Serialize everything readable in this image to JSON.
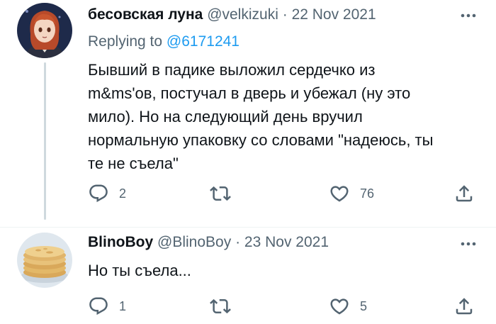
{
  "tweets": [
    {
      "author_name": "бесовская луна",
      "handle": "@velkizuki",
      "separator": "·",
      "date": "22 Nov 2021",
      "reply_prefix": "Replying to",
      "reply_to": "@6171241",
      "text": "Бывший в падике выложил сердечко из\nm&ms'ов, постучал в дверь и убежал (ну это\nмило). Но на следующий день вручил\nнормальную упаковку со словами \"надеюсь, ты\nте не съела\"",
      "replies": "2",
      "retweets": "",
      "likes": "76",
      "avatar_icon": "anime-girl-avatar"
    },
    {
      "author_name": "BlinoBoy",
      "handle": "@BlinoBoy",
      "separator": "·",
      "date": "23 Nov 2021",
      "text": "Но ты съела...",
      "replies": "1",
      "retweets": "",
      "likes": "5",
      "avatar_icon": "pancakes-avatar"
    }
  ],
  "colors": {
    "text": "#0f1419",
    "secondary": "#536471",
    "link": "#1d9bf0",
    "thread_line": "#cfd9de"
  },
  "icons": [
    "reply-icon",
    "retweet-icon",
    "like-icon",
    "share-icon",
    "more-icon"
  ]
}
